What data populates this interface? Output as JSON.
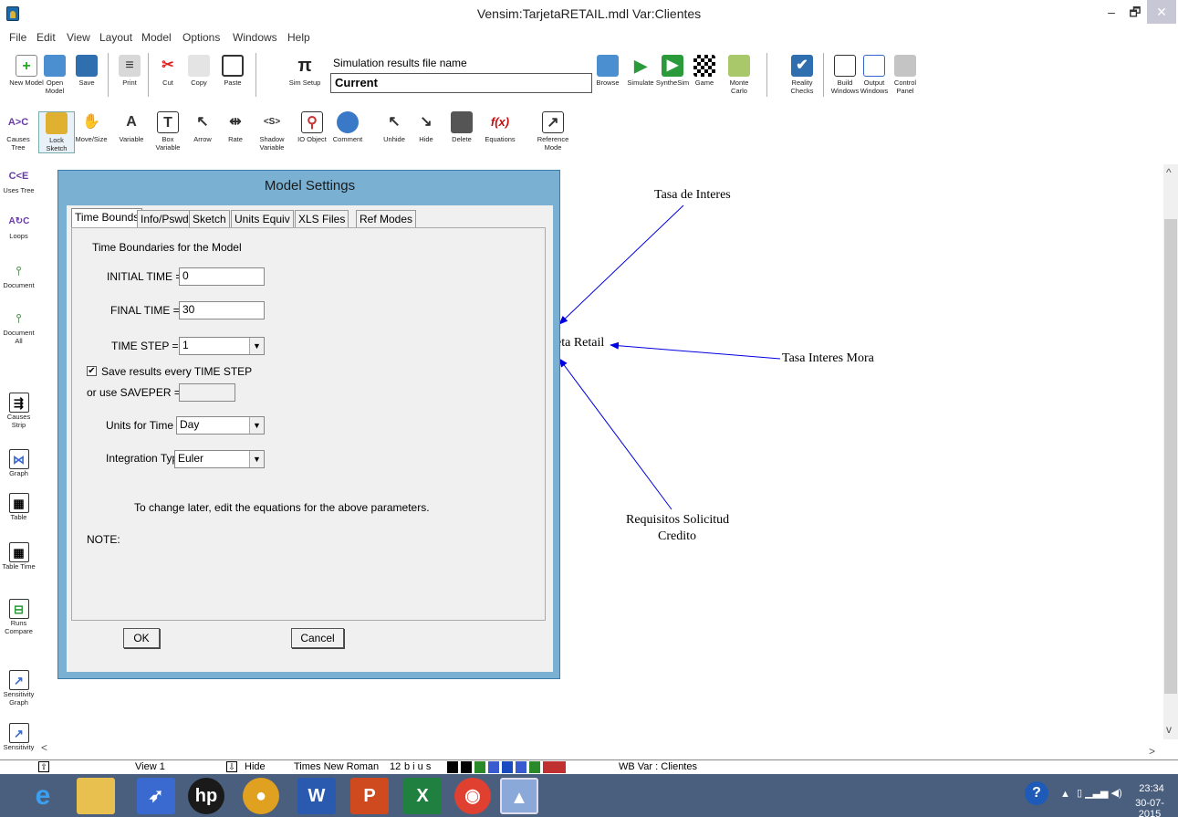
{
  "window": {
    "title": "Vensim:TarjetaRETAIL.mdl Var:Clientes",
    "minimize": "–",
    "maximize": "🗗",
    "close": "✕"
  },
  "menu": [
    "File",
    "Edit",
    "View",
    "Layout",
    "Model",
    "Options",
    "Windows",
    "Help"
  ],
  "toolbar1": {
    "buttons": [
      {
        "label": "New Model",
        "icon": "new-model-icon"
      },
      {
        "label": "Open Model",
        "icon": "open-model-icon"
      },
      {
        "label": "Save",
        "icon": "save-icon"
      },
      {
        "label": "Print",
        "icon": "print-icon"
      },
      {
        "label": "Cut",
        "icon": "cut-icon"
      },
      {
        "label": "Copy",
        "icon": "copy-icon"
      },
      {
        "label": "Paste",
        "icon": "paste-icon"
      },
      {
        "label": "Sim Setup",
        "icon": "sim-setup-icon"
      }
    ],
    "sim_results_label": "Simulation results file name",
    "sim_results_value": "Current",
    "right_buttons": [
      {
        "label": "Browse",
        "icon": "browse-icon"
      },
      {
        "label": "Simulate",
        "icon": "simulate-icon"
      },
      {
        "label": "SyntheSim",
        "icon": "synthesim-icon"
      },
      {
        "label": "Game",
        "icon": "game-icon"
      },
      {
        "label": "Monte Carlo",
        "icon": "monte-carlo-icon"
      },
      {
        "label": "Reality Checks",
        "icon": "reality-checks-icon"
      },
      {
        "label": "Build Windows",
        "icon": "build-windows-icon"
      },
      {
        "label": "Output Windows",
        "icon": "output-windows-icon"
      },
      {
        "label": "Control Panel",
        "icon": "control-panel-icon"
      }
    ]
  },
  "toolbar2": [
    {
      "label": "Causes Tree",
      "icon": "causes-tree-icon"
    },
    {
      "label": "Lock Sketch",
      "icon": "lock-icon"
    },
    {
      "label": "Move/Size",
      "icon": "hand-icon"
    },
    {
      "label": "Variable",
      "icon": "variable-icon"
    },
    {
      "label": "Box Variable",
      "icon": "box-variable-icon"
    },
    {
      "label": "Arrow",
      "icon": "arrow-icon"
    },
    {
      "label": "Rate",
      "icon": "rate-icon"
    },
    {
      "label": "Shadow Variable",
      "icon": "shadow-variable-icon"
    },
    {
      "label": "IO Object",
      "icon": "io-object-icon"
    },
    {
      "label": "Comment",
      "icon": "comment-icon"
    },
    {
      "label": "Unhide",
      "icon": "unhide-icon"
    },
    {
      "label": "Hide",
      "icon": "hide-icon"
    },
    {
      "label": "Delete",
      "icon": "delete-icon"
    },
    {
      "label": "Equations",
      "icon": "equations-icon",
      "glyph": "f(x)"
    },
    {
      "label": "Reference Mode",
      "icon": "reference-mode-icon"
    }
  ],
  "leftbar": [
    {
      "label": "Uses Tree",
      "icon": "uses-tree-icon"
    },
    {
      "label": "Loops",
      "icon": "loops-icon"
    },
    {
      "label": "Document",
      "icon": "document-icon"
    },
    {
      "label": "Document All",
      "icon": "document-all-icon"
    },
    {
      "label": "Causes Strip",
      "icon": "causes-strip-icon"
    },
    {
      "label": "Graph",
      "icon": "graph-icon"
    },
    {
      "label": "Table",
      "icon": "table-icon"
    },
    {
      "label": "Table Time",
      "icon": "table-time-icon"
    },
    {
      "label": "Runs Compare",
      "icon": "runs-compare-icon"
    },
    {
      "label": "Sensitivity Graph",
      "icon": "sensitivity-graph-icon"
    },
    {
      "label": "Sensitivity",
      "icon": "sensitivity-icon"
    }
  ],
  "dialog": {
    "title": "Model Settings",
    "tabs": [
      "Time Bounds",
      "Info/Pswd",
      "Sketch",
      "Units Equiv",
      "XLS Files",
      "Ref Modes"
    ],
    "heading": "Time Boundaries for the Model",
    "initial_time_label": "INITIAL TIME =",
    "initial_time_value": "0",
    "final_time_label": "FINAL TIME =",
    "final_time_value": "30",
    "time_step_label": "TIME STEP =",
    "time_step_value": "1",
    "save_every_label": "Save results every TIME STEP",
    "save_every_checked": "✔",
    "saveper_label": "or use SAVEPER =",
    "saveper_value": "",
    "units_label": "Units for Time",
    "units_value": "Day",
    "integration_label": "Integration Type",
    "integration_value": "Euler",
    "hint": "To change later, edit the equations for the above parameters.",
    "note_label": "NOTE:",
    "ok": "OK",
    "cancel": "Cancel"
  },
  "diagram": {
    "nodes": {
      "tasa_interes": "Tasa de Interes",
      "tarjeta_retail": "eta Retail",
      "tasa_mora": "Tasa Interes Mora",
      "requisitos_1": "Requisitos Solicitud",
      "requisitos_2": "Credito"
    },
    "arrow_color": "#0000e0"
  },
  "statusbar": {
    "view": "View 1",
    "hide": "Hide",
    "font": "Times New Roman",
    "size": "12",
    "styles": "b i u s",
    "var": "WB Var : Clientes"
  },
  "taskbar": {
    "apps": [
      "ie-icon",
      "file-explorer-icon",
      "rocket-icon",
      "hp-icon",
      "media-player-icon",
      "word-icon",
      "powerpoint-icon",
      "excel-icon",
      "chrome-icon",
      "vensim-icon"
    ],
    "time": "23:34",
    "date": "30-07-2015"
  },
  "colors": {
    "dialog_frame": "#7ab1d3",
    "taskbar": "#4a5f7d",
    "arrow": "#0000e0"
  }
}
